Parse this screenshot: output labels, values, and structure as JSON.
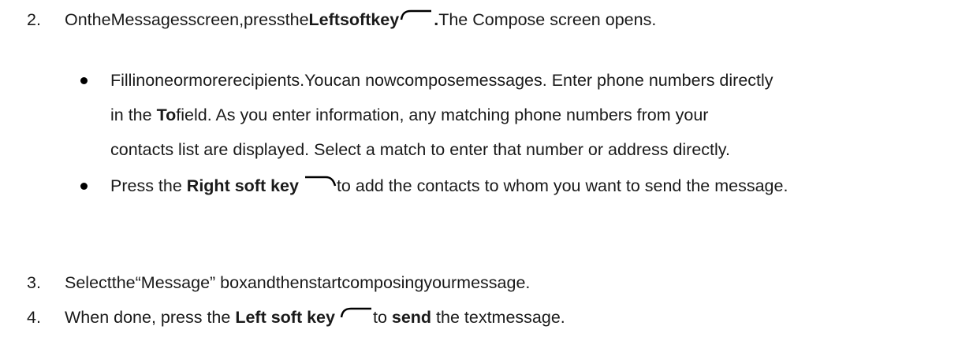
{
  "steps": [
    {
      "number": "2.",
      "segments": {
        "a": "OntheMessagesscreen,pressthe",
        "b_bold": "Leftsoftkey",
        "c_bold": ".",
        "d": "The Compose screen opens."
      },
      "icon": "left-soft-key-icon",
      "bullets": [
        {
          "lines": [
            {
              "a": "Fillinoneormorerecipients.Youcan nowcomposemessages. Enter phone numbers directly"
            },
            {
              "a": "in the ",
              "b_bold": "To",
              "c": "field. As you enter information, any matching phone numbers from your"
            },
            {
              "a": "contacts list are displayed. Select a match to enter that number or address directly."
            }
          ]
        },
        {
          "lines": [
            {
              "a": "Press the ",
              "b_bold": "Right soft key",
              "icon": "right-soft-key-icon",
              "c": "to add the contacts to whom you want to send the message."
            }
          ]
        }
      ]
    },
    {
      "number": "3.",
      "segments": {
        "a": "Selectthe“Message” boxandthenstartcomposingyourmessage."
      }
    },
    {
      "number": "4.",
      "segments": {
        "a": "When done, press the ",
        "b_bold": "Left soft key",
        "icon": "left-soft-key-icon",
        "c": "to ",
        "d_bold": "send",
        "e": " the textmessage."
      }
    }
  ]
}
